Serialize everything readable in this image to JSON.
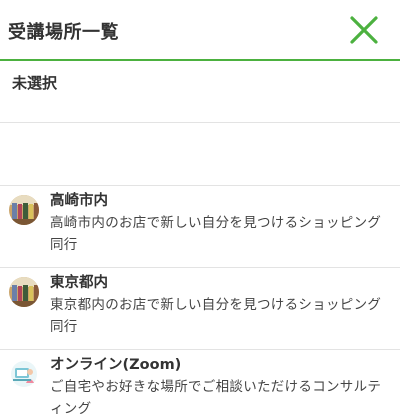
{
  "header": {
    "title": "受講場所一覧",
    "close_icon": "close-x-icon",
    "accent_color": "#4cb13f"
  },
  "unselected": {
    "label": "未選択"
  },
  "items": [
    {
      "title": "高崎市内",
      "description": "高崎市内のお店で新しい自分を見つけるショッピング同行",
      "icon": "shop-photo-avatar"
    },
    {
      "title": "東京都内",
      "description": "東京都内のお店で新しい自分を見つけるショッピング同行",
      "icon": "shop-photo-avatar"
    },
    {
      "title": "オンライン(Zoom)",
      "description": "ご自宅やお好きな場所でご相談いただけるコンサルティング",
      "icon": "online-illustration-avatar"
    }
  ]
}
